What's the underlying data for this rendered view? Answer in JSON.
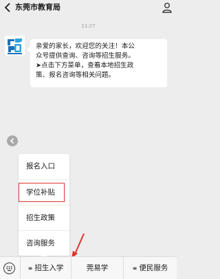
{
  "header": {
    "title": "东莞市教育局",
    "back_icon": "chevron-left-icon",
    "profile_icon": "person-icon"
  },
  "chat": {
    "timestamp": "11:27",
    "avatar_icon": "education-bureau-logo",
    "message_lines": [
      "亲爱的家长，欢迎您的关注！本公",
      "众号提供查询、咨询等招生服务。",
      "➤点击下方菜单，查看本地招生政",
      "策、报名咨询等相关问题。"
    ]
  },
  "popup_menu": {
    "items": [
      "报名入口",
      "学位补贴",
      "招生政策",
      "咨询服务"
    ],
    "highlighted_index": 1,
    "highlight_color": "#e0322f"
  },
  "bottom_bar": {
    "keyboard_icon": "keyboard-icon",
    "tabs": [
      {
        "label": "招生入学",
        "has_menu_icon": true
      },
      {
        "label": "莞易学",
        "has_menu_icon": false
      },
      {
        "label": "便民服务",
        "has_menu_icon": true
      }
    ],
    "annotation_color": "#e0322f"
  }
}
